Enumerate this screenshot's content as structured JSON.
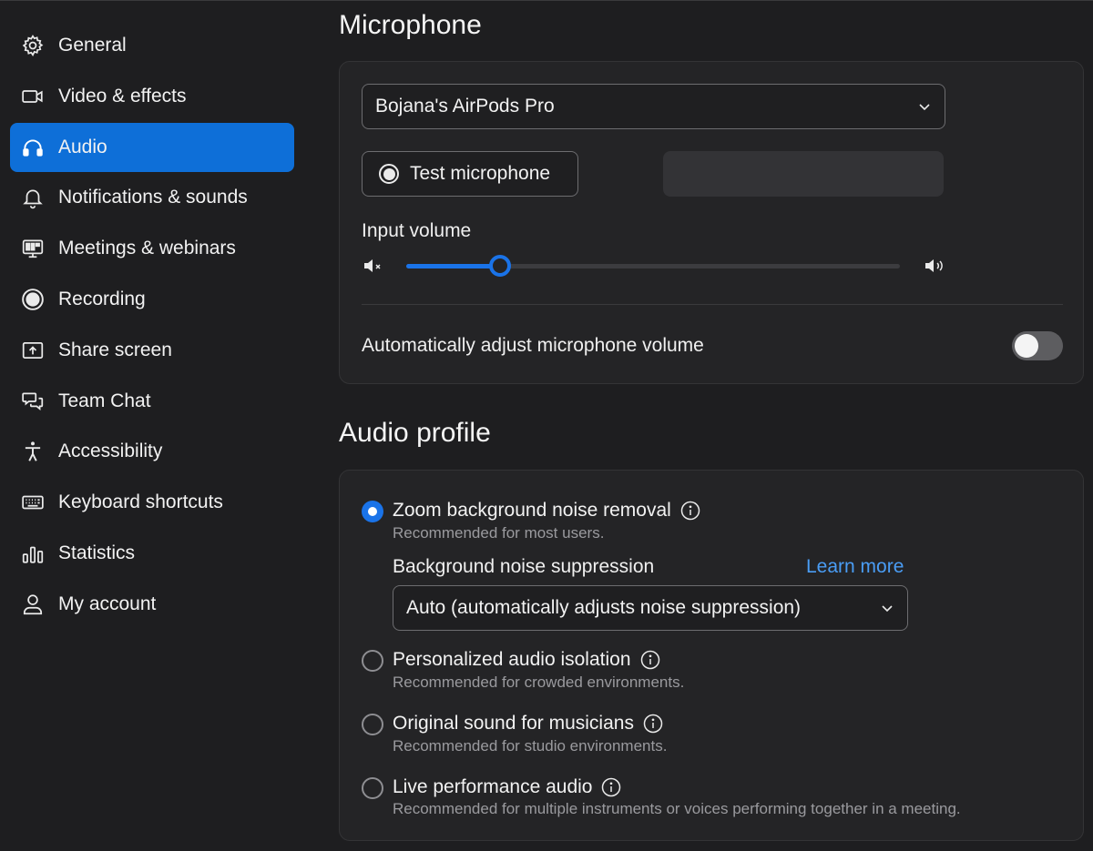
{
  "sidebar": {
    "items": [
      {
        "label": "General",
        "icon": "gear-icon"
      },
      {
        "label": "Video & effects",
        "icon": "video-camera-icon"
      },
      {
        "label": "Audio",
        "icon": "headphones-icon",
        "active": true
      },
      {
        "label": "Notifications & sounds",
        "icon": "bell-icon"
      },
      {
        "label": "Meetings & webinars",
        "icon": "meeting-monitor-icon"
      },
      {
        "label": "Recording",
        "icon": "record-icon"
      },
      {
        "label": "Share screen",
        "icon": "share-screen-icon"
      },
      {
        "label": "Team Chat",
        "icon": "chat-bubbles-icon"
      },
      {
        "label": "Accessibility",
        "icon": "accessibility-icon"
      },
      {
        "label": "Keyboard shortcuts",
        "icon": "keyboard-icon"
      },
      {
        "label": "Statistics",
        "icon": "bar-chart-icon"
      },
      {
        "label": "My account",
        "icon": "user-icon"
      }
    ]
  },
  "microphone": {
    "title": "Microphone",
    "device": "Bojana's AirPods Pro",
    "test_button": "Test microphone",
    "input_volume_label": "Input volume",
    "input_volume_level": 0.19,
    "auto_adjust_label": "Automatically adjust microphone volume",
    "auto_adjust_on": false
  },
  "audio_profile": {
    "title": "Audio profile",
    "options": [
      {
        "title": "Zoom background noise removal",
        "subtitle": "Recommended for most users.",
        "selected": true
      },
      {
        "title": "Personalized audio isolation",
        "subtitle": "Recommended for crowded environments.",
        "selected": false
      },
      {
        "title": "Original sound for musicians",
        "subtitle": "Recommended for studio environments.",
        "selected": false
      },
      {
        "title": "Live performance audio",
        "subtitle": "Recommended for multiple instruments or voices performing together in a meeting.",
        "selected": false
      }
    ],
    "suppression_label": "Background noise suppression",
    "learn_more": "Learn more",
    "suppression_value": "Auto (automatically adjusts noise suppression)"
  },
  "colors": {
    "accent": "#1a73e8",
    "link": "#4a9df5",
    "background": "#1e1e20",
    "card": "#242426"
  }
}
